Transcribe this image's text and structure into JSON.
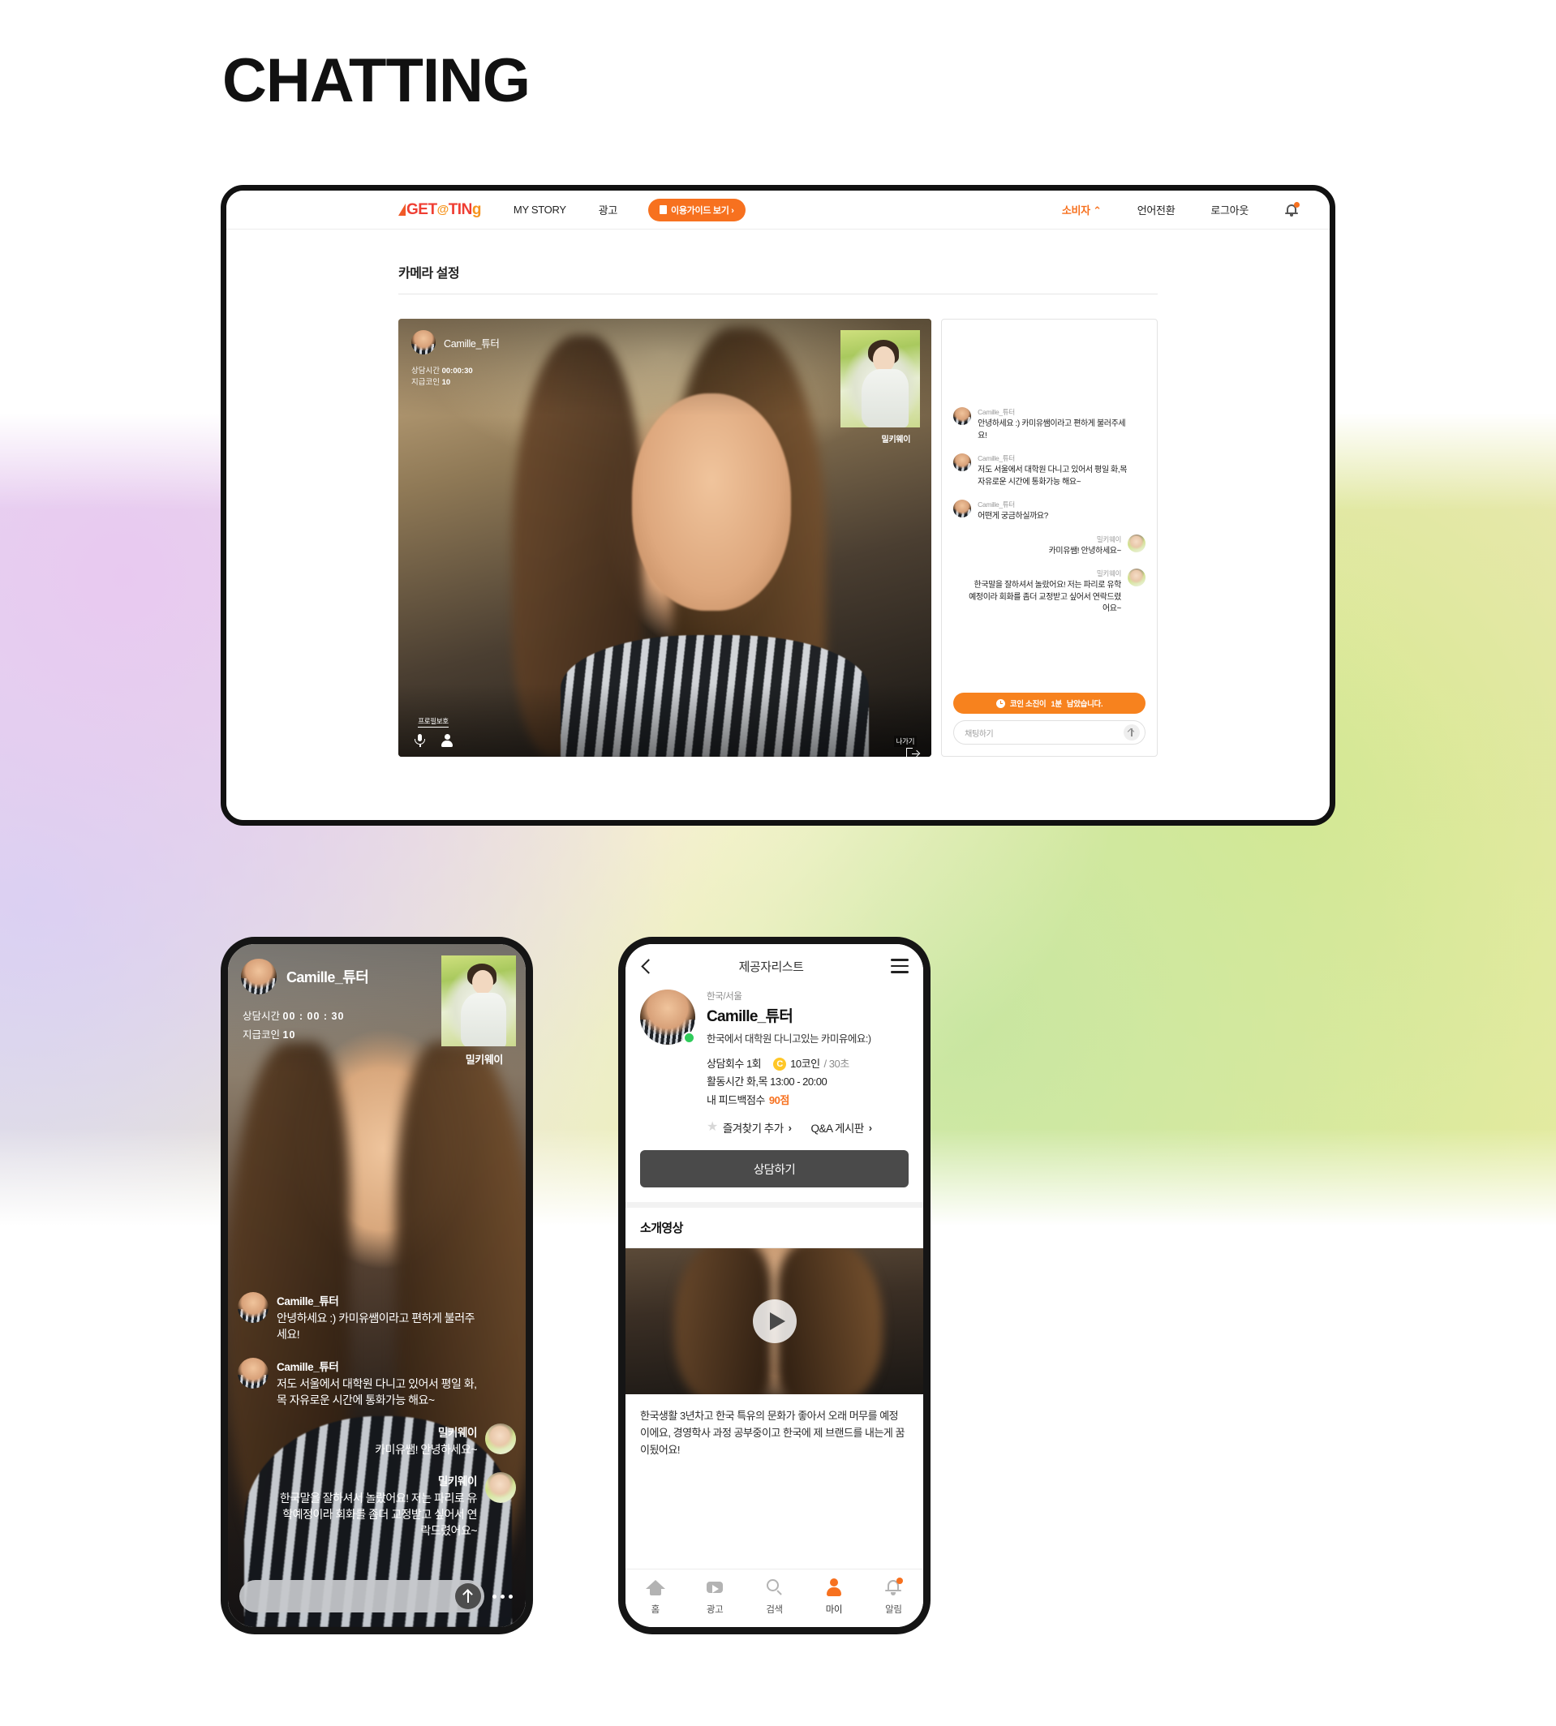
{
  "page": {
    "title": "CHATTING"
  },
  "desktop": {
    "nav": {
      "logo": {
        "get": "GET",
        "at": "@",
        "tin": "TIN",
        "g": "g"
      },
      "links": [
        {
          "label": "MY STORY",
          "name": "my-story"
        },
        {
          "label": "광고",
          "name": "ads"
        }
      ],
      "guide_button": "이용가이드 보기 ›",
      "right": [
        {
          "label": "소비자 ⌃",
          "name": "consumer"
        },
        {
          "label": "언어전환",
          "name": "language-switch"
        },
        {
          "label": "로그아웃",
          "name": "logout"
        }
      ]
    },
    "section_title": "카메라 설정",
    "video": {
      "tutor_name": "Camille_튜터",
      "duration_label": "상담시간",
      "duration_value": "00:00:30",
      "coin_label": "지급코인",
      "coin_value": "10",
      "pip_name": "밀키웨이",
      "profile_protect": "프로필보호",
      "exit": "나가기"
    },
    "chat": {
      "messages": [
        {
          "side": "left",
          "who": "Camille_튜터",
          "text": "안녕하세요 :) 카미유쌤이라고 편하게 불러주세요!"
        },
        {
          "side": "left",
          "who": "Camille_튜터",
          "text": "저도 서울에서 대학원 다니고 있어서 평일 화,목 자유로운 시간에 통화가능 해요~"
        },
        {
          "side": "left",
          "who": "Camille_튜터",
          "text": "어떤게 궁금하실까요?"
        },
        {
          "side": "right",
          "who": "밀키웨이",
          "text": "카미유쌤! 안녕하세요~"
        },
        {
          "side": "right",
          "who": "밀키웨이",
          "text": "한국말을 잘하셔서 놀랐어요! 저는 파리로 유학예정이라 회화를 좀더 교정받고 싶어서 연락드렸어요~"
        }
      ],
      "coin_notice_pre": "코인 소진이",
      "coin_notice_highlight": "1분",
      "coin_notice_post": "남았습니다.",
      "input_placeholder": "채팅하기"
    }
  },
  "phone1": {
    "tutor_name": "Camille_튜터",
    "duration_label": "상담시간",
    "duration_value": "00 : 00 : 30",
    "coin_label": "지급코인",
    "coin_value": "10",
    "pip_name": "밀키웨이",
    "messages": [
      {
        "side": "left",
        "who": "Camille_튜터",
        "text": "안녕하세요 :) 카미유쌤이라고 편하게 불러주세요!"
      },
      {
        "side": "left",
        "who": "Camille_튜터",
        "text": "저도 서울에서 대학원 다니고 있어서 평일 화,목 자유로운 시간에 통화가능 해요~"
      },
      {
        "side": "right",
        "who": "밀키웨이",
        "text": "카미유쌤! 안녕하세요~"
      },
      {
        "side": "right",
        "who": "밀키웨이",
        "text": "한국말을 잘하셔서 놀랐어요! 저는 파리로 유학예정이라 회화를 좀더 교정받고 싶어서 연락드렸어요~"
      }
    ],
    "input_placeholder": ""
  },
  "phone2": {
    "header_title": "제공자리스트",
    "location": "한국/서울",
    "name": "Camille_튜터",
    "bio": "한국에서 대학원 다니고있는 카미유에요:)",
    "stats": {
      "sessions_label": "상담회수 1회",
      "coin_symbol": "C",
      "coin_value": "10코인",
      "coin_unit": "/ 30초",
      "hours": "활동시간 화,목 13:00 - 20:00",
      "feedback_label": "내 피드백점수",
      "feedback_score": "90점"
    },
    "actions": [
      {
        "label": "즐겨찾기 추가",
        "name": "add-favorite"
      },
      {
        "label": "Q&A 게시판",
        "name": "qna-board"
      }
    ],
    "cta": "상담하기",
    "video_section_title": "소개영상",
    "description": "한국생활 3년차고 한국 특유의 문화가 좋아서 오래 머무를 예정 이에요, 경영학사 과정 공부중이고 한국에 제 브랜드를 내는게 꿈이됬어요!",
    "tabs": [
      {
        "label": "홈",
        "icon": "home-icon",
        "active": false
      },
      {
        "label": "광고",
        "icon": "play-icon",
        "active": false
      },
      {
        "label": "검색",
        "icon": "search-icon",
        "active": false
      },
      {
        "label": "마이",
        "icon": "user-icon",
        "active": true
      },
      {
        "label": "알림",
        "icon": "bell-icon",
        "active": false
      }
    ]
  },
  "colors": {
    "accent": "#f7711f",
    "coin": "#ffc727",
    "online": "#2fcb5b",
    "cta": "#4a4a4a"
  }
}
